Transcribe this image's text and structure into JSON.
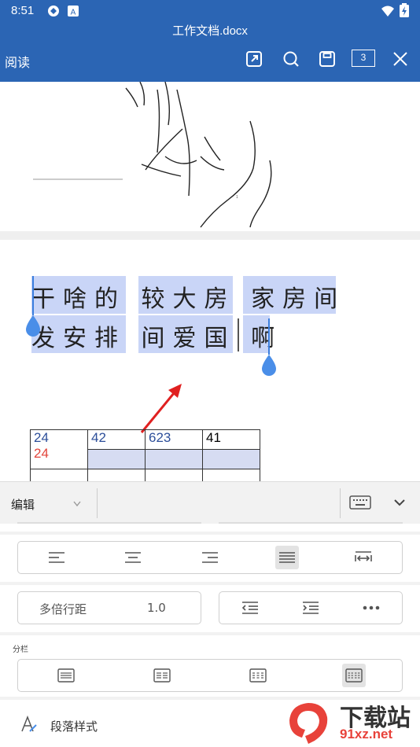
{
  "status_bar": {
    "time": "8:51"
  },
  "title_bar": {
    "document_name": "工作文档.docx",
    "mode_label": "阅读",
    "page_count": "3"
  },
  "document": {
    "line1": "干啥的 较大房 家房间",
    "line2": "发安排 间爱国 啊",
    "table": {
      "row1": [
        "24",
        "42",
        "623",
        "41"
      ],
      "row1_col1_extra": "24"
    }
  },
  "toolbar": {
    "style_dropdown": "编辑"
  },
  "panel": {
    "line_spacing_label": "多倍行距",
    "line_spacing_value": "1.0",
    "columns_label": "分栏",
    "paragraph_style_label": "段落样式"
  },
  "watermark": {
    "text": "下载站",
    "url": "91xz.net"
  },
  "colors": {
    "accent": "#2b65b4",
    "selection": "#c9d5f7",
    "handle": "#4a8ee8",
    "arrow": "#e02020"
  }
}
